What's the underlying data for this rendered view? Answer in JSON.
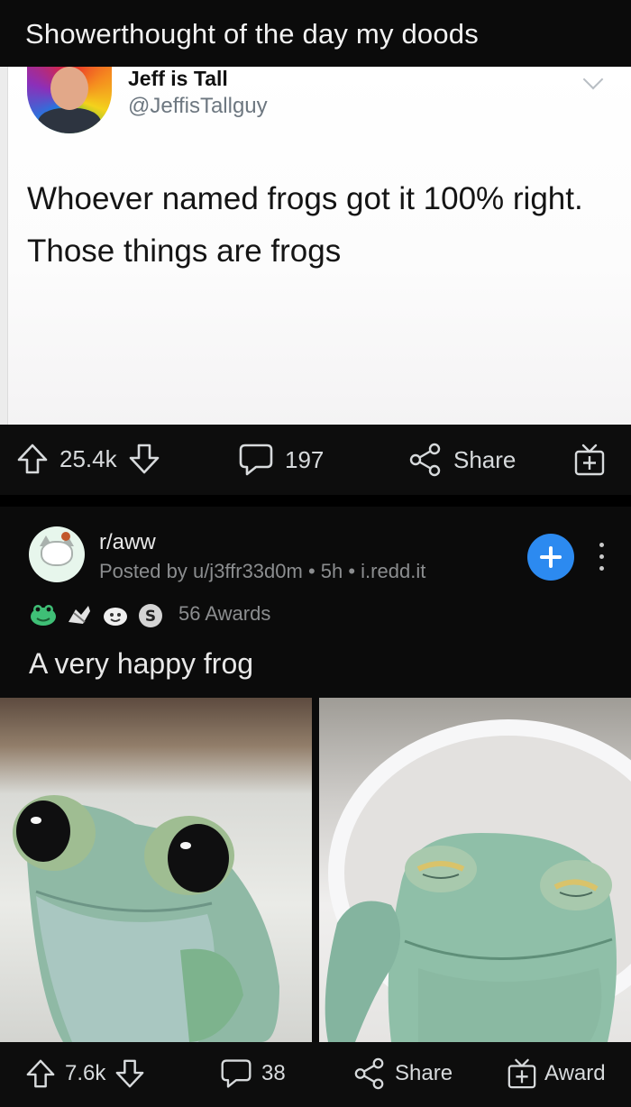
{
  "header": {
    "title": "Showerthought of the day my doods"
  },
  "tweet": {
    "author_name": "Jeff is Tall",
    "author_handle": "@JeffisTallguy",
    "text": "Whoever named frogs got it 100% right. Those things are frogs"
  },
  "first_post_actions": {
    "score": "25.4k",
    "comments": "197",
    "share_label": "Share"
  },
  "second_post": {
    "subreddit": "r/aww",
    "meta": "Posted by u/j3ffr33d0m • 5h • i.redd.it",
    "awards_count": "56 Awards",
    "title": "A very happy frog",
    "score": "7.6k",
    "comments": "38",
    "share_label": "Share",
    "award_label": "Award"
  },
  "colors": {
    "join_button": "#2c8af0",
    "background": "#0b0b0b",
    "text": "#d7dadc",
    "meta_text": "#8b8d8f"
  },
  "icons": [
    "upvote-icon",
    "downvote-icon",
    "comment-icon",
    "share-icon",
    "gift-icon",
    "plus-icon",
    "more-vertical-icon",
    "chevron-down-icon",
    "award-icon"
  ]
}
